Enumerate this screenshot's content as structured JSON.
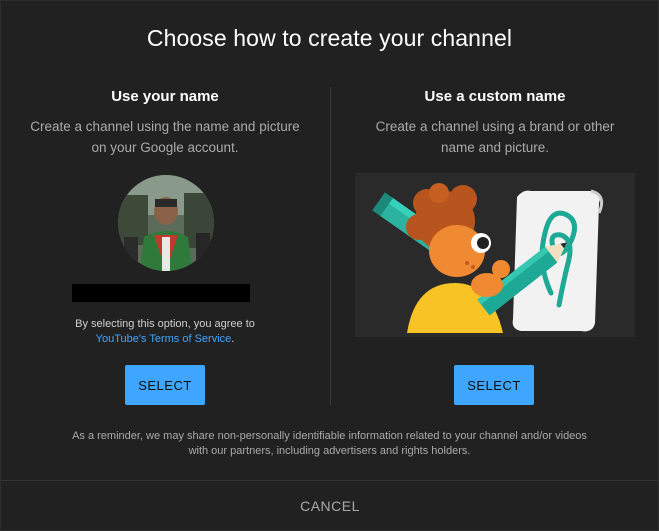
{
  "dialog": {
    "title": "Choose how to create your channel",
    "reminder_line1": "As a reminder, we may share non-personally identifiable information related to your channel and/or videos",
    "reminder_line2": "with our partners, including advertisers and rights holders.",
    "cancel_label": "CANCEL"
  },
  "left": {
    "heading": "Use your name",
    "desc_line1": "Create a channel using the name and picture",
    "desc_line2": "on your Google account.",
    "agree_text": "By selecting this option, you agree to",
    "tos_link": "YouTube's Terms of Service",
    "tos_suffix": ".",
    "select_label": "SELECT"
  },
  "right": {
    "heading": "Use a custom name",
    "desc_line1": "Create a channel using a brand or other",
    "desc_line2": "name and picture.",
    "select_label": "SELECT"
  },
  "colors": {
    "accent": "#3ea6ff",
    "background": "#212121",
    "muted_text": "#aaaaaa"
  },
  "icons": {
    "avatar": "profile-photo",
    "illustration": "person-drawing-with-pencil"
  }
}
